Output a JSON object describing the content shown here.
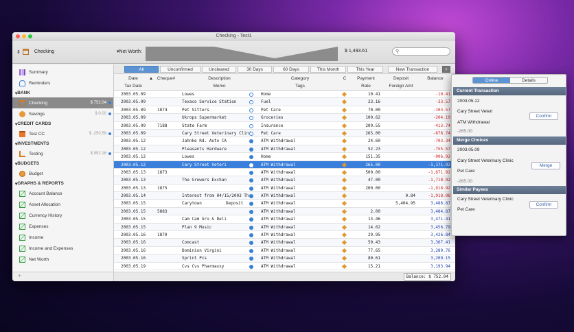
{
  "window": {
    "title": "Checking - Test1"
  },
  "toolbar": {
    "account": "Checking",
    "networth_label": "Net Worth:",
    "networth_value": "$ 1,493.61",
    "search_placeholder": ""
  },
  "sidebar": {
    "top": [
      {
        "label": "Summary"
      },
      {
        "label": "Reminders"
      }
    ],
    "bank_head": "BANK",
    "bank": [
      {
        "label": "Checking",
        "amount": "$ 752.04",
        "selected": true
      },
      {
        "label": "Savings",
        "amount": "$ 0.00"
      }
    ],
    "cc_head": "CREDIT CARDS",
    "cc": [
      {
        "label": "Test CC",
        "amount": "$ -250.59"
      }
    ],
    "inv_head": "INVESTMENTS",
    "inv": [
      {
        "label": "Testing",
        "amount": "$ 992.16"
      }
    ],
    "budgets_head": "BUDGETS",
    "budgets": [
      {
        "label": "Budget"
      }
    ],
    "graphs_head": "GRAPHS & REPORTS",
    "graphs": [
      {
        "label": "Account Balance"
      },
      {
        "label": "Asset Allocation"
      },
      {
        "label": "Currency History"
      },
      {
        "label": "Expenses"
      },
      {
        "label": "Income"
      },
      {
        "label": "Income and Expenses"
      },
      {
        "label": "Net Worth"
      }
    ],
    "bottom_add": "+"
  },
  "filters": [
    {
      "label": "All",
      "active": true
    },
    {
      "label": "Unconfirmed"
    },
    {
      "label": "Uncleared"
    },
    {
      "label": "30 Days"
    },
    {
      "label": "60 Days"
    },
    {
      "label": "This Month"
    },
    {
      "label": "This Year"
    }
  ],
  "new_transaction": "New Transaction",
  "columns": {
    "date": "Date",
    "taxdate": "Tax Date",
    "cheque": "Cheque#",
    "description": "Description",
    "memo": "Memo",
    "category": "Category",
    "tags": "Tags",
    "c": "C",
    "payment": "Payment",
    "rate": "Rate",
    "deposit": "Deposit",
    "foreign": "Foreign Amt",
    "balance": "Balance"
  },
  "rows": [
    {
      "date": "2003.05.09",
      "cheque": "",
      "desc": "Lowes",
      "cat": "Home",
      "pay": "10.41",
      "dep": "",
      "bal": "-10.41",
      "circ": "open",
      "neg": true
    },
    {
      "date": "2003.05.09",
      "cheque": "",
      "desc": "Texaco Service Station",
      "cat": "Fuel",
      "pay": "23.16",
      "dep": "",
      "bal": "-33.57",
      "circ": "open",
      "neg": true
    },
    {
      "date": "2003.05.09",
      "cheque": "1874",
      "desc": "Pet Sitters",
      "cat": "Pet Care",
      "pay": "70.00",
      "dep": "",
      "bal": "-103.57",
      "circ": "open",
      "neg": true
    },
    {
      "date": "2003.05.09",
      "cheque": "",
      "desc": "Ukrops Supermarket",
      "cat": "Groceries",
      "pay": "100.62",
      "dep": "",
      "bal": "-204.19",
      "circ": "open",
      "neg": true
    },
    {
      "date": "2003.05.09",
      "cheque": "7188",
      "desc": "State Farm",
      "cat": "Insurance",
      "pay": "209.55",
      "dep": "",
      "bal": "-413.74",
      "circ": "open",
      "neg": true
    },
    {
      "date": "2003.05.09",
      "cheque": "",
      "desc": "Cary Street Veterinary Clinic",
      "cat": "Pet Care",
      "pay": "265.00",
      "dep": "",
      "bal": "-678.74",
      "circ": "open",
      "neg": true
    },
    {
      "date": "2003.05.12",
      "cheque": "",
      "desc": "Jahnke Rd. Auto CA",
      "cat": "ATM Withdrawal",
      "pay": "24.60",
      "dep": "",
      "bal": "-703.34",
      "circ": "filled",
      "neg": true
    },
    {
      "date": "2003.05.12",
      "cheque": "",
      "desc": "Pleasants Hardware",
      "cat": "ATM Withdrawal",
      "pay": "52.23",
      "dep": "",
      "bal": "-755.57",
      "circ": "filled",
      "neg": true
    },
    {
      "date": "2003.05.12",
      "cheque": "",
      "desc": "Lowes",
      "cat": "Home",
      "pay": "151.35",
      "dep": "",
      "bal": "-906.92",
      "circ": "filled",
      "neg": true
    },
    {
      "date": "2003.05.12",
      "cheque": "",
      "desc": "Cary Street Veteri",
      "cat": "ATM Withdrawal",
      "pay": "265.00",
      "dep": "",
      "bal": "-1,171.92",
      "circ": "white",
      "neg": true,
      "selected": true
    },
    {
      "date": "2003.05.13",
      "cheque": "1873",
      "desc": "",
      "cat": "ATM Withdrawal",
      "pay": "500.00",
      "dep": "",
      "bal": "-1,671.92",
      "circ": "filled",
      "neg": true
    },
    {
      "date": "2003.05.13",
      "cheque": "",
      "desc": "The Growers Exchan",
      "cat": "ATM Withdrawal",
      "pay": "47.00",
      "dep": "",
      "bal": "-1,718.92",
      "circ": "filled",
      "neg": true
    },
    {
      "date": "2003.05.13",
      "cheque": "1875",
      "desc": "",
      "cat": "ATM Withdrawal",
      "pay": "200.00",
      "dep": "",
      "bal": "-1,918.92",
      "circ": "filled",
      "neg": true
    },
    {
      "date": "2003.05.14",
      "cheque": "",
      "desc": "Interest from 04/15/2003 Thr",
      "cat": "ATM Withdrawal",
      "pay": "",
      "dep": "0.84",
      "bal": "-1,918.08",
      "circ": "filled",
      "neg": true
    },
    {
      "date": "2003.05.15",
      "cheque": "",
      "desc": "Carytown",
      "memo": "Deposit",
      "cat": "ATM Withdrawal",
      "pay": "",
      "dep": "5,404.95",
      "bal": "3,486.87",
      "circ": "filled",
      "neg": false
    },
    {
      "date": "2003.05.15",
      "cheque": "5883",
      "desc": "",
      "cat": "ATM Withdrawal",
      "pay": "2.00",
      "dep": "",
      "bal": "3,484.87",
      "circ": "filled",
      "neg": false
    },
    {
      "date": "2003.05.15",
      "cheque": "",
      "desc": "Cam Cam Gro & Deli",
      "cat": "ATM Withdrawal",
      "pay": "13.46",
      "dep": "",
      "bal": "3,471.41",
      "circ": "filled",
      "neg": false
    },
    {
      "date": "2003.05.15",
      "cheque": "",
      "desc": "Plan 9 Music",
      "cat": "ATM Withdrawal",
      "pay": "14.62",
      "dep": "",
      "bal": "3,456.79",
      "circ": "filled",
      "neg": false
    },
    {
      "date": "2003.05.16",
      "cheque": "1870",
      "desc": "",
      "cat": "ATM Withdrawal",
      "pay": "29.95",
      "dep": "",
      "bal": "3,426.84",
      "circ": "filled",
      "neg": false
    },
    {
      "date": "2003.05.16",
      "cheque": "",
      "desc": "Comcast",
      "cat": "ATM Withdrawal",
      "pay": "59.43",
      "dep": "",
      "bal": "3,367.41",
      "circ": "filled",
      "neg": false
    },
    {
      "date": "2003.05.16",
      "cheque": "",
      "desc": "Dominion Virgini",
      "cat": "ATM Withdrawal",
      "pay": "77.65",
      "dep": "",
      "bal": "3,289.76",
      "circ": "filled",
      "neg": false
    },
    {
      "date": "2003.05.16",
      "cheque": "",
      "desc": "Sprint Pcs",
      "cat": "ATM Withdrawal",
      "pay": "80.61",
      "dep": "",
      "bal": "3,209.15",
      "circ": "filled",
      "neg": false
    },
    {
      "date": "2003.05.19",
      "cheque": "",
      "desc": "Cvs Cvs Pharmaxxy",
      "cat": "ATM Withdrawal",
      "pay": "15.21",
      "dep": "",
      "bal": "3,193.94",
      "circ": "filled",
      "neg": false
    }
  ],
  "status": {
    "balance": "Balance: $ 752.04"
  },
  "panel": {
    "tab_online": "Online",
    "tab_details": "Details",
    "current_head": "Current Transaction",
    "current_date": "2003.05.12",
    "current_payee": "Cary Street Veteri",
    "current_cat": "ATM Withdrawal",
    "current_amt": "-265.00",
    "confirm": "Confirm",
    "merge_head": "Merge Choices",
    "merge_date": "2003.05.09",
    "merge_payee": "Cary Street Veterinary Clinic",
    "merge_cat": "Pet Care",
    "merge_amt": "-265.00",
    "merge": "Merge",
    "similar_head": "Similar Payees",
    "similar_payee": "Cary Street Veterinary Clinic",
    "similar_cat": "Pet Care",
    "confirm2": "Confirm"
  },
  "colors": {
    "accent": "#3b7fdc",
    "negative": "#d02020",
    "positive": "#1d3fb3",
    "diamond": "#e2962d"
  }
}
